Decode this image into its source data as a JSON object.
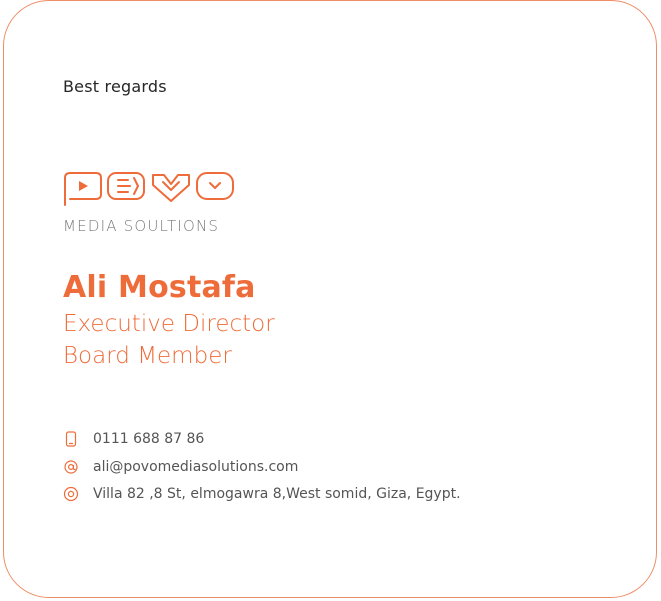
{
  "greeting": "Best regards",
  "logo": {
    "wordmark": "POVO",
    "subtitle": "MEDIA SOULTIONS"
  },
  "person": {
    "name": "Ali Mostafa",
    "title_line1": "Executive Director",
    "title_line2": "Board Member"
  },
  "contact": {
    "phone": "0111 688 87 86",
    "email": "ali@povomediasolutions.com",
    "address": "Villa 82 ,8 St, elmogawra 8,West somid, Giza, Egypt."
  },
  "icons": {
    "phone": "phone-icon",
    "email": "at-icon",
    "address": "location-pin-icon"
  },
  "colors": {
    "accent": "#ee6c3a",
    "border": "#ef8d67",
    "text": "#262626",
    "muted": "#555555"
  }
}
